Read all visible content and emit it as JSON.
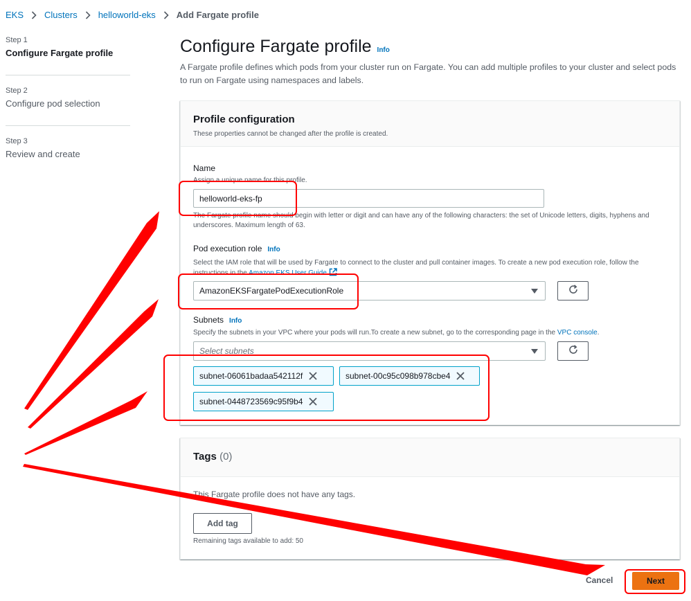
{
  "breadcrumb": {
    "items": [
      "EKS",
      "Clusters",
      "helloworld-eks"
    ],
    "current": "Add Fargate profile"
  },
  "steps": [
    {
      "number": "Step 1",
      "title": "Configure Fargate profile"
    },
    {
      "number": "Step 2",
      "title": "Configure pod selection"
    },
    {
      "number": "Step 3",
      "title": "Review and create"
    }
  ],
  "header": {
    "title": "Configure Fargate profile",
    "info": "Info",
    "description": "A Fargate profile defines which pods from your cluster run on Fargate. You can add multiple profiles to your cluster and select pods to run on Fargate using namespaces and labels."
  },
  "profile": {
    "title": "Profile configuration",
    "subtitle": "These properties cannot be changed after the profile is created.",
    "name_label": "Name",
    "name_hint": "Assign a unique name for this profile.",
    "name_value": "helloworld-eks-fp",
    "name_constraint": "The Fargate profile name should begin with letter or digit and can have any of the following characters: the set of Unicode letters, digits, hyphens and underscores. Maximum length of 63.",
    "role_label": "Pod execution role",
    "role_info": "Info",
    "role_hint": "Select the IAM role that will be used by Fargate to connect to the cluster and pull container images. To create a new pod execution role, follow the instructions in the",
    "role_hint_link": "Amazon EKS User Guide",
    "role_value": "AmazonEKSFargatePodExecutionRole",
    "subnets_label": "Subnets",
    "subnets_info": "Info",
    "subnets_hint": "Specify the subnets in your VPC where your pods will run.To create a new subnet, go to the corresponding page in the",
    "subnets_hint_link": "VPC console",
    "subnets_placeholder": "Select subnets",
    "subnets": [
      "subnet-06061badaa542112f",
      "subnet-00c95c098b978cbe4",
      "subnet-0448723569c95f9b4"
    ]
  },
  "tags": {
    "title": "Tags",
    "count": "(0)",
    "empty": "This Fargate profile does not have any tags.",
    "add_label": "Add tag",
    "remaining": "Remaining tags available to add: 50"
  },
  "footer": {
    "cancel": "Cancel",
    "next": "Next"
  },
  "colors": {
    "link": "#0073bb",
    "primary": "#ec7211",
    "annotation": "#ff0000",
    "token_border": "#00a1c9"
  }
}
